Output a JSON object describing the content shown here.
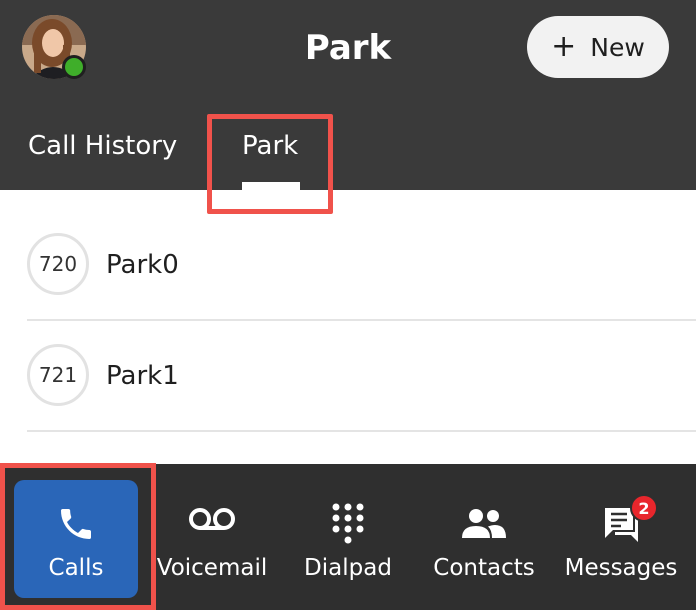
{
  "header": {
    "title": "Park",
    "new_button": {
      "label": "New",
      "icon": "plus-icon"
    },
    "presence_status": "online",
    "presence_color": "#3fae2a"
  },
  "tabs": [
    {
      "label": "Call History",
      "selected": false
    },
    {
      "label": "Park",
      "selected": true
    }
  ],
  "park_list": [
    {
      "extension": "720",
      "name": "Park0"
    },
    {
      "extension": "721",
      "name": "Park1"
    }
  ],
  "bottom_nav": {
    "items": [
      {
        "label": "Calls",
        "icon": "phone-icon",
        "selected": true
      },
      {
        "label": "Voicemail",
        "icon": "voicemail-icon",
        "selected": false
      },
      {
        "label": "Dialpad",
        "icon": "dialpad-icon",
        "selected": false
      },
      {
        "label": "Contacts",
        "icon": "contacts-icon",
        "selected": false
      },
      {
        "label": "Messages",
        "icon": "messages-icon",
        "selected": false,
        "badge": "2"
      }
    ]
  },
  "colors": {
    "header_bg": "#3a3a3a",
    "nav_bg": "#2f2f2f",
    "accent": "#2a66b8",
    "highlight": "#f0524b",
    "badge": "#e8262c"
  }
}
